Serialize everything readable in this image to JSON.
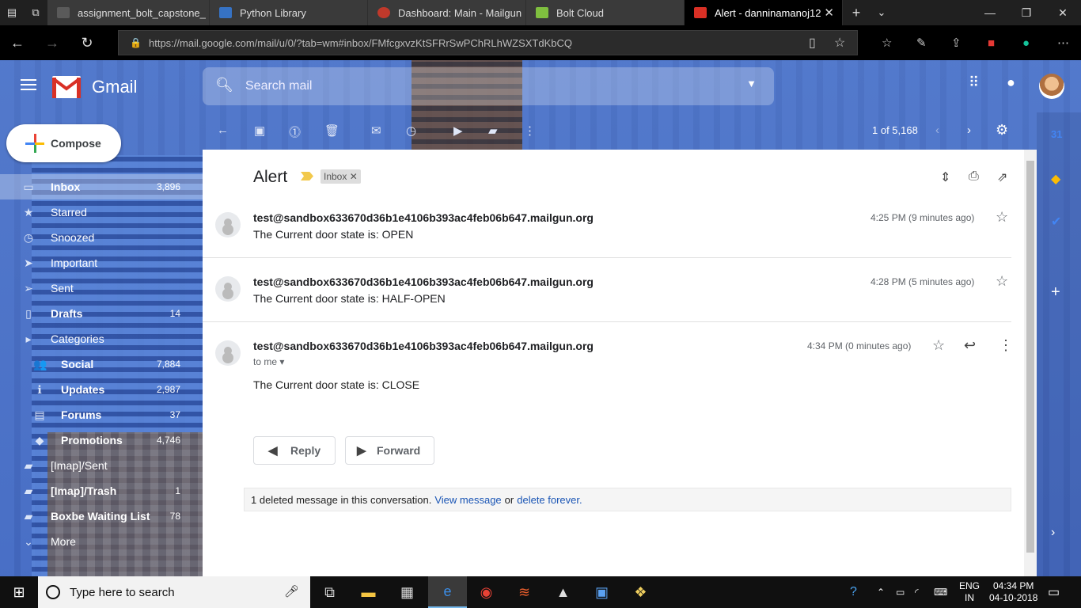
{
  "browser": {
    "tabs": [
      {
        "title": "assignment_bolt_capstone_",
        "color": "#5a5a5a"
      },
      {
        "title": "Python Library",
        "color": "#3672c4"
      },
      {
        "title": "Dashboard: Main - Mailgun",
        "color": "#c0392b"
      },
      {
        "title": "Bolt Cloud",
        "color": "#7fbf3f"
      },
      {
        "title": "Alert - danninamanoj12",
        "color": "#d93025"
      }
    ],
    "url": "https://mail.google.com/mail/u/0/?tab=wm#inbox/FMfcgxvzKtSFRrSwPChRLhWZSXTdKbCQ"
  },
  "gmail": {
    "brand": "Gmail",
    "search_placeholder": "Search mail",
    "compose_label": "Compose",
    "pagination": "1 of 5,168",
    "sidebar": [
      {
        "icon": "inbox-icon",
        "glyph": "▭",
        "label": "Inbox",
        "count": "3,896",
        "active": true,
        "bold": true
      },
      {
        "icon": "star-icon",
        "glyph": "★",
        "label": "Starred",
        "count": ""
      },
      {
        "icon": "clock-icon",
        "glyph": "◷",
        "label": "Snoozed",
        "count": ""
      },
      {
        "icon": "important-icon",
        "glyph": "➤",
        "label": "Important",
        "count": ""
      },
      {
        "icon": "send-icon",
        "glyph": "➢",
        "label": "Sent",
        "count": ""
      },
      {
        "icon": "draft-icon",
        "glyph": "▯",
        "label": "Drafts",
        "count": "14",
        "bold": true
      },
      {
        "icon": "category-icon",
        "glyph": "▸",
        "label": "Categories",
        "count": ""
      },
      {
        "icon": "people-icon",
        "glyph": "👥",
        "label": "Social",
        "count": "7,884",
        "sub": true
      },
      {
        "icon": "info-icon",
        "glyph": "ℹ",
        "label": "Updates",
        "count": "2,987",
        "sub": true
      },
      {
        "icon": "forum-icon",
        "glyph": "▤",
        "label": "Forums",
        "count": "37",
        "sub": true
      },
      {
        "icon": "tag-icon",
        "glyph": "◆",
        "label": "Promotions",
        "count": "4,746",
        "sub": true
      },
      {
        "icon": "label-icon",
        "glyph": "▰",
        "label": "[Imap]/Sent",
        "count": ""
      },
      {
        "icon": "label-icon",
        "glyph": "▰",
        "label": "[Imap]/Trash",
        "count": "1",
        "bold": true
      },
      {
        "icon": "label-icon",
        "glyph": "▰",
        "label": "Boxbe Waiting List",
        "count": "78",
        "bold": true
      },
      {
        "icon": "chevron-down-icon",
        "glyph": "⌄",
        "label": "More",
        "count": ""
      }
    ],
    "thread": {
      "subject": "Alert",
      "label": "Inbox",
      "messages": [
        {
          "sender": "test@sandbox633670d36b1e4106b393ac4feb06b647.mailgun.org",
          "snippet": "The Current door state is: OPEN",
          "time": "4:25 PM (9 minutes ago)"
        },
        {
          "sender": "test@sandbox633670d36b1e4106b393ac4feb06b647.mailgun.org",
          "snippet": "The Current door state is: HALF-OPEN",
          "time": "4:28 PM (5 minutes ago)"
        },
        {
          "sender": "test@sandbox633670d36b1e4106b393ac4feb06b647.mailgun.org",
          "recipient": "to me",
          "body": "The Current door state is: CLOSE",
          "time": "4:34 PM (0 minutes ago)"
        }
      ],
      "reply_label": "Reply",
      "forward_label": "Forward",
      "deleted_notice": "1 deleted message in this conversation.",
      "view_message": "View message",
      "or_text": "or",
      "delete_forever": "delete forever."
    }
  },
  "taskbar": {
    "search_placeholder": "Type here to search",
    "lang_top": "ENG",
    "lang_bottom": "IN",
    "time": "04:34 PM",
    "date": "04-10-2018"
  }
}
